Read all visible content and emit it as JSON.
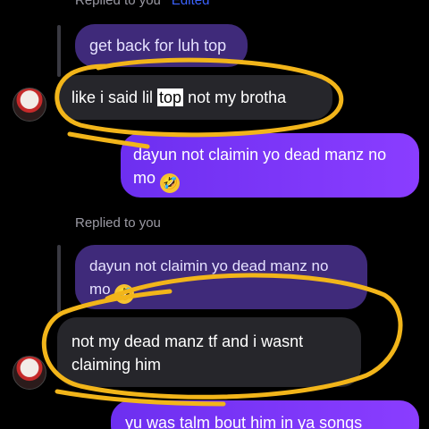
{
  "colors": {
    "background": "#000000",
    "incoming_bubble": "#26262b",
    "quoted_bubble": "#3f2a7a",
    "outgoing_bubble": "#7c35f7",
    "annotation": "#f2b51a",
    "link_blue": "#3b63ff"
  },
  "top_cutoff": {
    "label": "Replied to you",
    "edited": "Edited"
  },
  "thread": [
    {
      "role": "quoted",
      "text": "get back for luh top"
    },
    {
      "role": "incoming",
      "before": "like i said lil ",
      "highlight": "top",
      "after": " not my brotha"
    },
    {
      "role": "outgoing",
      "text": "dayun not claimin yo dead manz no mo",
      "emoji": "rolling-on-floor-laughing"
    },
    {
      "role": "meta",
      "text": "Replied to you"
    },
    {
      "role": "quoted",
      "text": "dayun not claimin yo dead manz no mo",
      "emoji": "rolling-on-floor-laughing"
    },
    {
      "role": "incoming",
      "text": "not my dead manz tf and i wasnt claiming him"
    },
    {
      "role": "outgoing",
      "text": "yu was talm bout him in ya songs"
    }
  ],
  "emoji_glyph": "🤣"
}
